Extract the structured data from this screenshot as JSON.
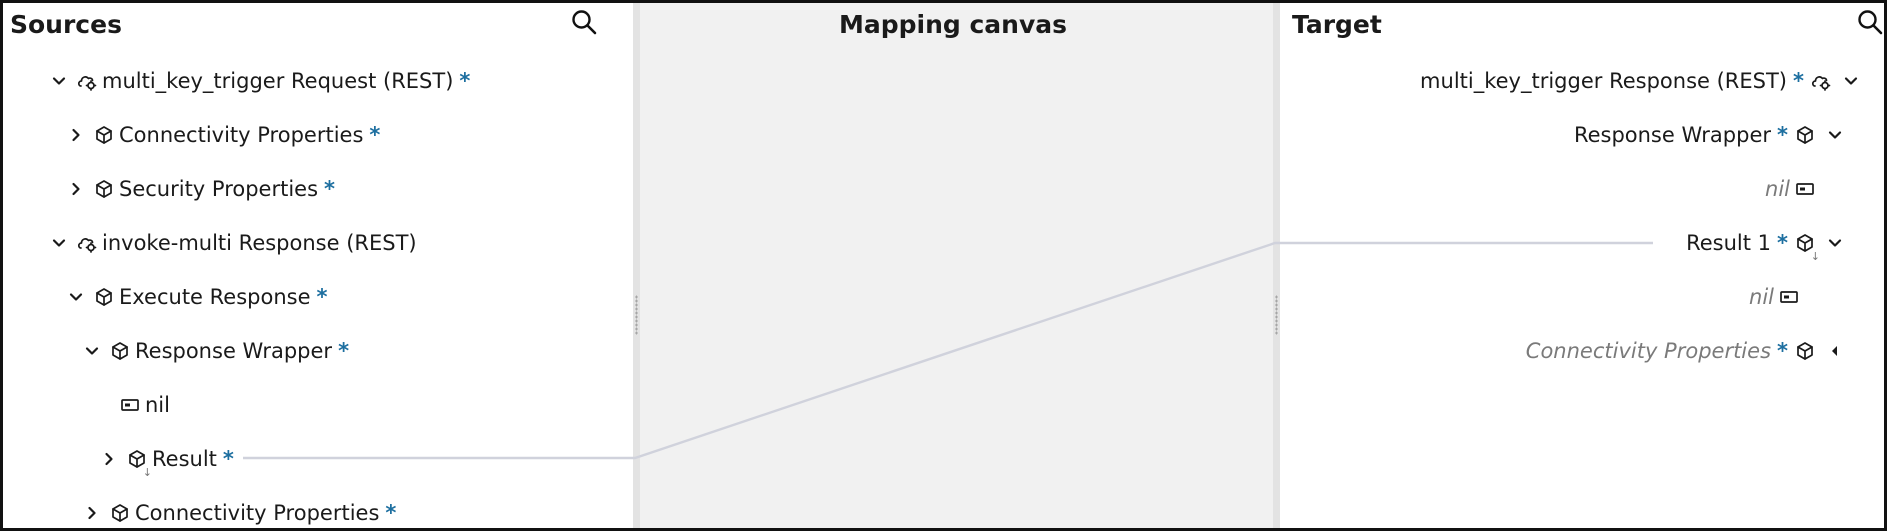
{
  "sources": {
    "title": "Sources",
    "search_icon": "search-icon",
    "rows": [
      {
        "label": "multi_key_trigger Request (REST)",
        "icon": "cloud-gear-icon",
        "expand": "expanded",
        "star": "*"
      },
      {
        "label": "Connectivity Properties",
        "icon": "cube-icon",
        "expand": "collapsed",
        "star": "*"
      },
      {
        "label": "Security Properties",
        "icon": "cube-icon",
        "expand": "collapsed",
        "star": "*"
      },
      {
        "label": "invoke-multi Response (REST)",
        "icon": "cloud-gear-icon",
        "expand": "expanded",
        "star": ""
      },
      {
        "label": "Execute Response",
        "icon": "cube-icon",
        "expand": "expanded",
        "star": "*"
      },
      {
        "label": "Response Wrapper",
        "icon": "cube-icon",
        "expand": "expanded",
        "star": "*"
      },
      {
        "label": "nil",
        "icon": "attribute-icon",
        "expand": "none",
        "star": ""
      },
      {
        "label": "Result",
        "icon": "repeating-cube-icon",
        "expand": "collapsed",
        "star": "*"
      },
      {
        "label": "Connectivity Properties",
        "icon": "cube-icon",
        "expand": "collapsed",
        "star": "*"
      }
    ]
  },
  "canvas": {
    "title": "Mapping canvas",
    "line_color": "#d0d2dc"
  },
  "target": {
    "title": "Target",
    "search_icon": "search-icon",
    "rows": [
      {
        "label": "multi_key_trigger Response (REST)",
        "icon": "cloud-gear-icon",
        "expand": "expanded",
        "star": "*"
      },
      {
        "label": "Response Wrapper",
        "icon": "cube-icon",
        "expand": "expanded",
        "star": "*"
      },
      {
        "label": "nil",
        "icon": "attribute-icon",
        "expand": "none",
        "star": ""
      },
      {
        "label": "Result 1",
        "icon": "repeating-cube-icon",
        "expand": "expanded",
        "star": "*"
      },
      {
        "label": "nil",
        "icon": "attribute-icon",
        "expand": "none",
        "star": ""
      },
      {
        "label": "Connectivity Properties",
        "icon": "cube-icon",
        "expand": "collapsed-left",
        "star": "*"
      }
    ]
  },
  "colors": {
    "star": "#1d6fa0",
    "canvas_bg": "#f1f1f1",
    "italic_text": "#7a7a7a"
  }
}
